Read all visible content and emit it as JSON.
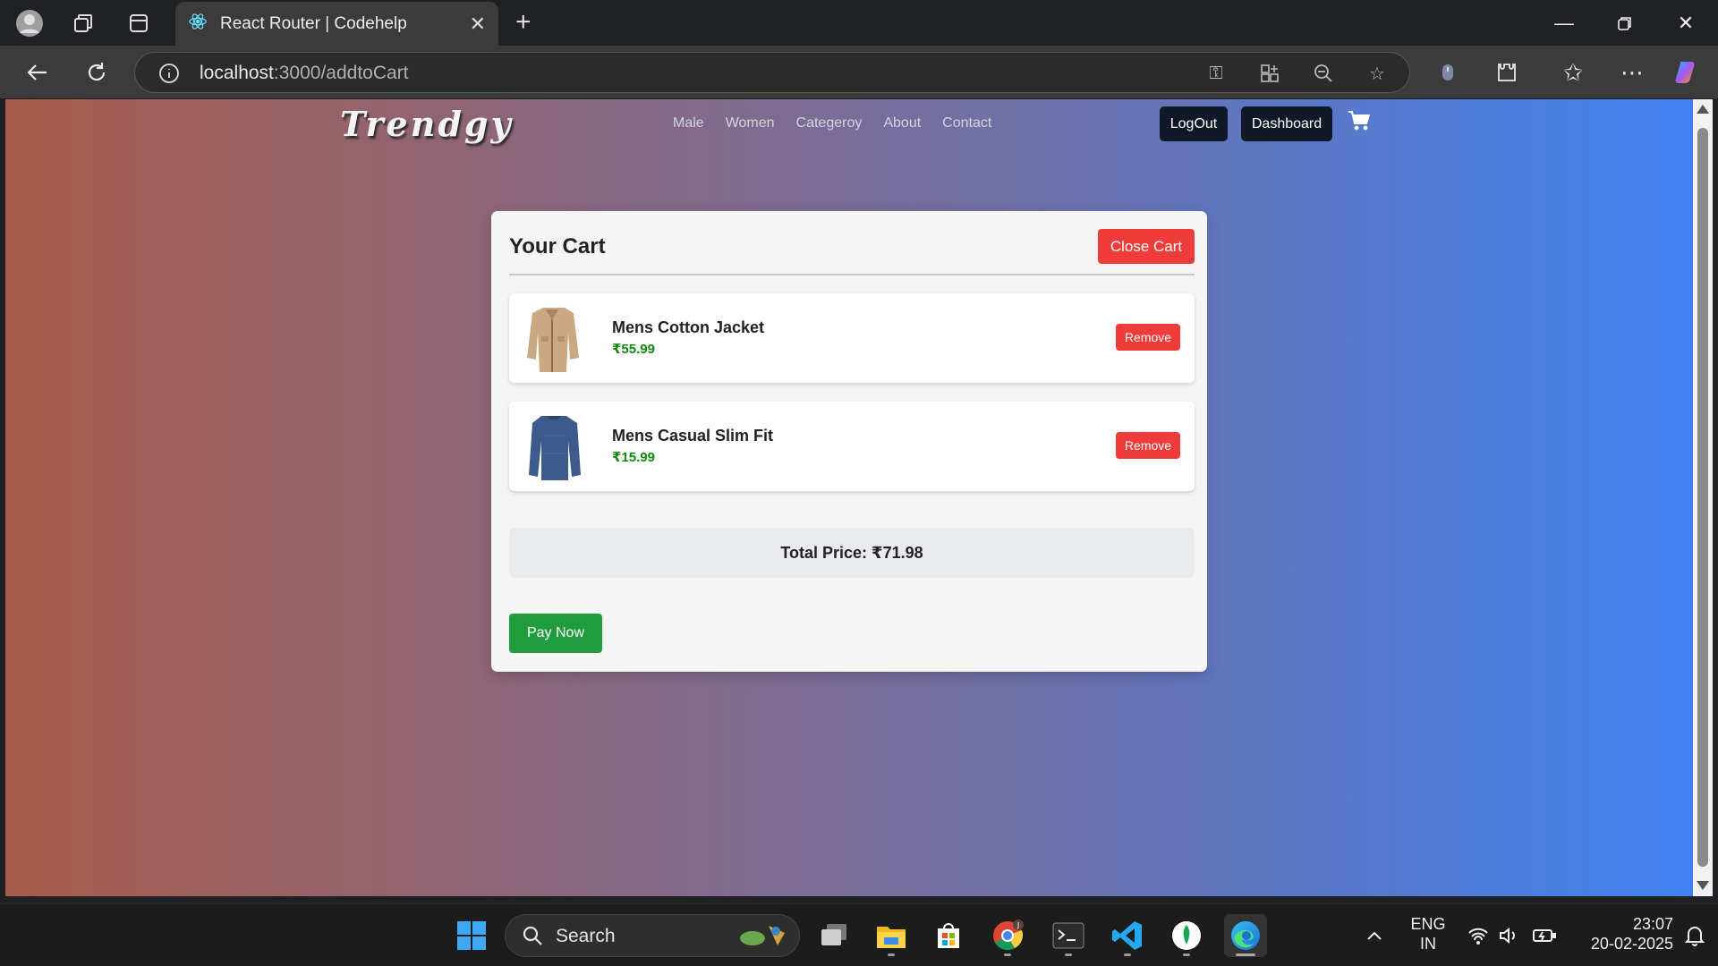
{
  "browser": {
    "tab_title": "React Router | Codehelp",
    "url_host": "localhost",
    "url_path": ":3000/addtoCart"
  },
  "site": {
    "logo": "Trendgy",
    "nav": [
      "Male",
      "Women",
      "Categeroy",
      "About",
      "Contact"
    ],
    "logout_label": "LogOut",
    "dashboard_label": "Dashboard"
  },
  "cart": {
    "title": "Your Cart",
    "close_label": "Close Cart",
    "items": [
      {
        "name": "Mens Cotton Jacket",
        "price": "₹55.99",
        "remove_label": "Remove"
      },
      {
        "name": "Mens Casual Slim Fit",
        "price": "₹15.99",
        "remove_label": "Remove"
      }
    ],
    "total": "Total Price: ₹71.98",
    "pay_label": "Pay Now"
  },
  "taskbar": {
    "search_label": "Search",
    "lang_top": "ENG",
    "lang_bottom": "IN",
    "time": "23:07",
    "date": "20-02-2025"
  },
  "colors": {
    "gradient_start": "#a85c4b",
    "gradient_end": "#3f82f0",
    "danger": "#f03b3b",
    "success": "#1f9d3c",
    "price": "#118a11",
    "header_button": "#111827"
  }
}
